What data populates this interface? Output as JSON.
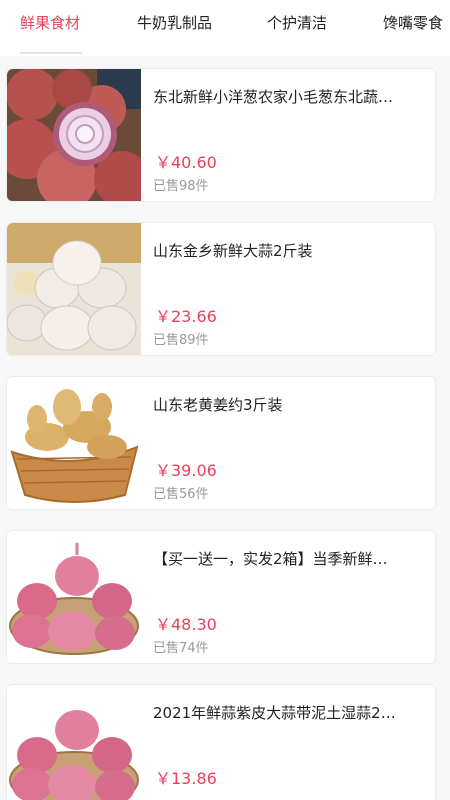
{
  "tabs": [
    {
      "label": "鲜果食材",
      "active": true
    },
    {
      "label": "牛奶乳制品",
      "active": false
    },
    {
      "label": "个护清洁",
      "active": false
    },
    {
      "label": "馋嘴零食",
      "active": false
    }
  ],
  "products": [
    {
      "title": "东北新鲜小洋葱农家小毛葱东北蔬…",
      "price": "￥40.60",
      "sold": "已售98件",
      "image": "red-onion-image"
    },
    {
      "title": "山东金乡新鲜大蒜2斤装",
      "price": "￥23.66",
      "sold": "已售89件",
      "image": "garlic-image"
    },
    {
      "title": "山东老黄姜约3斤装",
      "price": "￥39.06",
      "sold": "已售56件",
      "image": "ginger-image"
    },
    {
      "title": "【买一送一，实发2箱】当季新鲜…",
      "price": "￥48.30",
      "sold": "已售74件",
      "image": "purple-garlic-image"
    },
    {
      "title": "2021年鲜蒜紫皮大蒜带泥土湿蒜2…",
      "price": "￥13.86",
      "sold": "",
      "image": "purple-garlic-image"
    }
  ],
  "colors": {
    "accent": "#e8415b",
    "muted": "#9a9a9a"
  }
}
